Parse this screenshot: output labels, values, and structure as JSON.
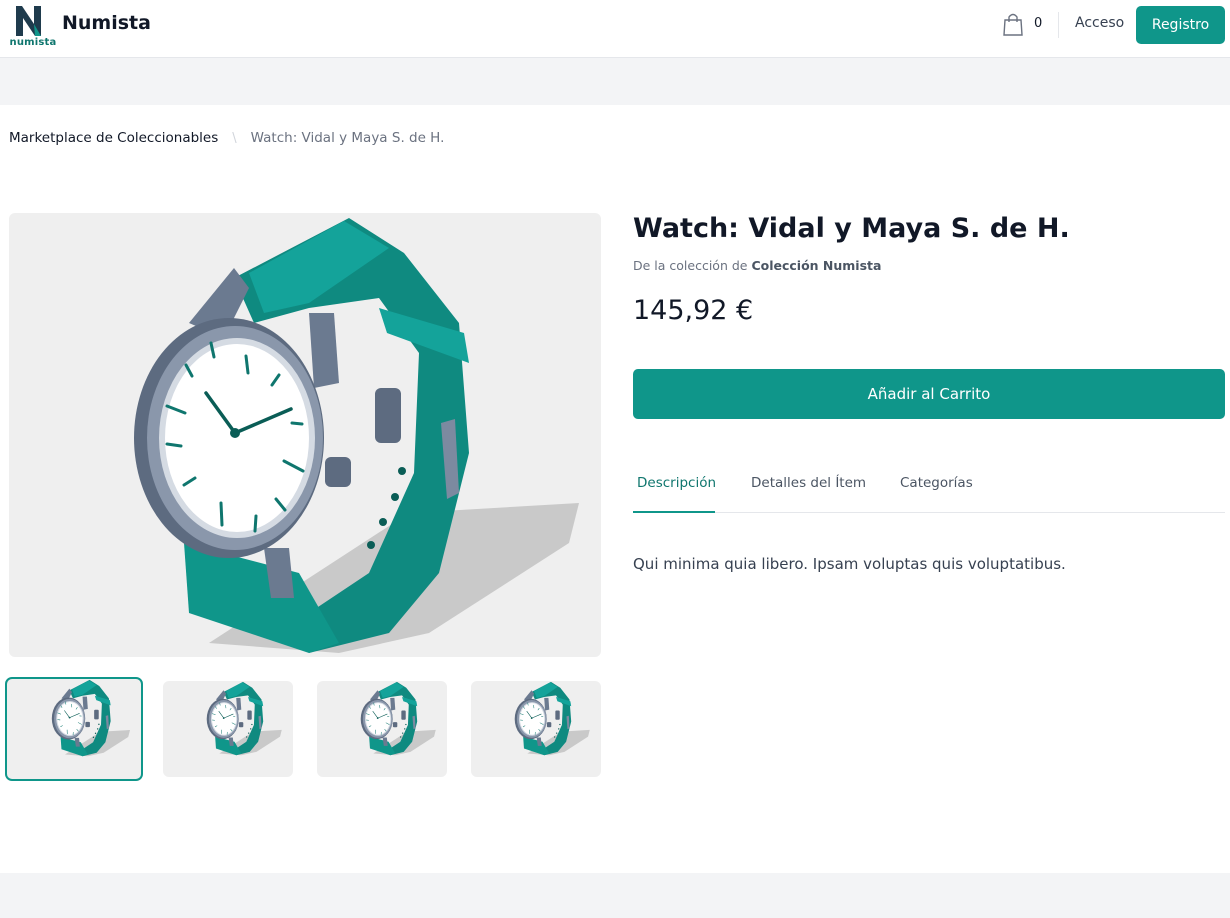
{
  "header": {
    "logo_text": "numista",
    "brand": "Numista",
    "cart_count": "0",
    "login_label": "Acceso",
    "register_label": "Registro",
    "accent_color": "#0f968a"
  },
  "breadcrumb": {
    "items": [
      "Marketplace de Coleccionables",
      "Watch: Vidal y Maya S. de H."
    ],
    "separator": "\\"
  },
  "product": {
    "title": "Watch: Vidal y Maya S. de H.",
    "collection_prefix": "De la colección de",
    "collection_name": "Colección Numista",
    "price": "145,92 €",
    "add_to_cart_label": "Añadir al Carrito",
    "tabs": [
      {
        "label": "Descripción",
        "active": true
      },
      {
        "label": "Detalles del Ítem",
        "active": false
      },
      {
        "label": "Categorías",
        "active": false
      }
    ],
    "description": "Qui minima quia libero. Ipsam voluptas quis voluptatibus."
  },
  "gallery": {
    "image_icon": "wristwatch-illustration",
    "thumbnail_count": 4,
    "active_thumbnail": 1
  }
}
